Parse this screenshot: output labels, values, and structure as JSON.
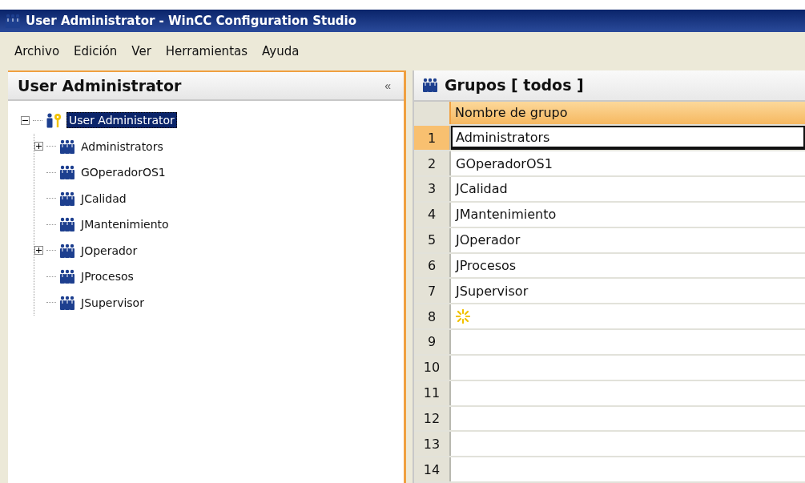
{
  "window": {
    "title": "User Administrator - WinCC Configuration Studio"
  },
  "menu": [
    {
      "label": "Archivo"
    },
    {
      "label": "Edición"
    },
    {
      "label": "Ver"
    },
    {
      "label": "Herramientas"
    },
    {
      "label": "Ayuda"
    }
  ],
  "navigation": {
    "title": "User Administrator",
    "collapse": "«",
    "tree": {
      "label": "User Administrator",
      "selected": true,
      "expanded": true,
      "children": [
        {
          "label": "Administrators",
          "selected": false,
          "has_children": true
        },
        {
          "label": "GOperadorOS1",
          "selected": false,
          "has_children": false
        },
        {
          "label": "JCalidad",
          "selected": false,
          "has_children": false
        },
        {
          "label": "JMantenimiento",
          "selected": false,
          "has_children": false
        },
        {
          "label": "JOperador",
          "selected": false,
          "has_children": true
        },
        {
          "label": "JProcesos",
          "selected": false,
          "has_children": false
        },
        {
          "label": "JSupervisor",
          "selected": false,
          "has_children": false
        }
      ]
    }
  },
  "table": {
    "title": "Grupos [ todos ]",
    "columns": [
      "Nombre de grupo"
    ],
    "rows": [
      {
        "number": "1",
        "kind": "data",
        "name": "Administrators",
        "selected": true
      },
      {
        "number": "2",
        "kind": "data",
        "name": "GOperadorOS1",
        "selected": false
      },
      {
        "number": "3",
        "kind": "data",
        "name": "JCalidad",
        "selected": false
      },
      {
        "number": "4",
        "kind": "data",
        "name": "JMantenimiento",
        "selected": false
      },
      {
        "number": "5",
        "kind": "data",
        "name": "JOperador",
        "selected": false
      },
      {
        "number": "6",
        "kind": "data",
        "name": "JProcesos",
        "selected": false
      },
      {
        "number": "7",
        "kind": "data",
        "name": "JSupervisor",
        "selected": false
      },
      {
        "number": "8",
        "kind": "new",
        "selected": false
      },
      {
        "number": "9",
        "kind": "empty",
        "selected": false
      },
      {
        "number": "10",
        "kind": "empty",
        "selected": false
      },
      {
        "number": "11",
        "kind": "empty",
        "selected": false
      },
      {
        "number": "12",
        "kind": "empty",
        "selected": false
      },
      {
        "number": "13",
        "kind": "empty",
        "selected": false
      },
      {
        "number": "14",
        "kind": "empty",
        "selected": false
      }
    ]
  }
}
